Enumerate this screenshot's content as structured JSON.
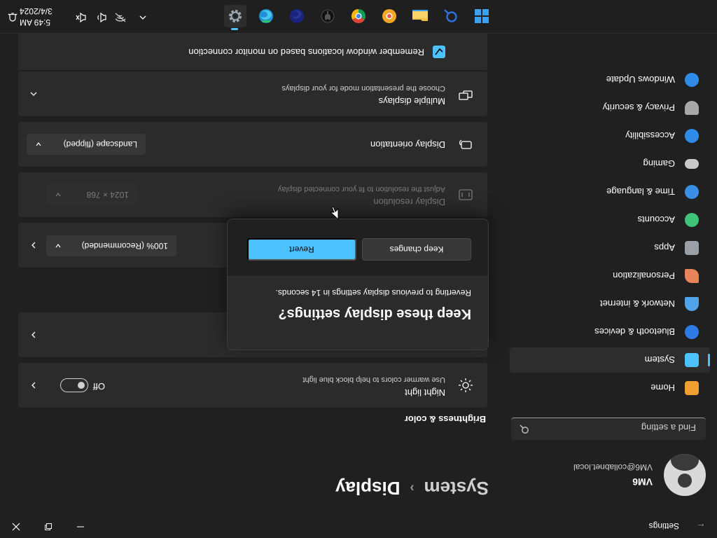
{
  "window": {
    "title": "Settings",
    "back_icon": "back-arrow-icon"
  },
  "profile": {
    "name": "VM6",
    "email": "VM6@collabnet.local"
  },
  "search": {
    "placeholder": "Find a setting"
  },
  "nav": {
    "items": [
      {
        "label": "Home",
        "icon": "home-icon",
        "color": "#f0a030"
      },
      {
        "label": "System",
        "icon": "system-icon",
        "color": "#4cc2ff",
        "selected": true
      },
      {
        "label": "Bluetooth & devices",
        "icon": "bluetooth-icon",
        "color": "#2f7be5"
      },
      {
        "label": "Network & internet",
        "icon": "network-icon",
        "color": "#4fa3e8"
      },
      {
        "label": "Personalization",
        "icon": "brush-icon",
        "color": "#e8845a"
      },
      {
        "label": "Apps",
        "icon": "apps-icon",
        "color": "#9aa0a6"
      },
      {
        "label": "Accounts",
        "icon": "accounts-icon",
        "color": "#3fc27a"
      },
      {
        "label": "Time & language",
        "icon": "globe-clock-icon",
        "color": "#3a8ee6"
      },
      {
        "label": "Gaming",
        "icon": "gamepad-icon",
        "color": "#c9c9c9"
      },
      {
        "label": "Accessibility",
        "icon": "accessibility-icon",
        "color": "#2f8be8"
      },
      {
        "label": "Privacy & security",
        "icon": "shield-icon",
        "color": "#a8a8a8"
      },
      {
        "label": "Windows Update",
        "icon": "update-icon",
        "color": "#2f8be8"
      }
    ]
  },
  "breadcrumb": {
    "parent": "System",
    "current": "Display"
  },
  "brightness_section": {
    "title": "Brightness & color"
  },
  "night_light": {
    "title": "Night light",
    "subtitle": "Use warmer colors to help block blue light",
    "state": "Off"
  },
  "scale": {
    "value": "100% (Recommended)"
  },
  "resolution": {
    "title": "Display resolution",
    "subtitle": "Adjust the resolution to fit your connected display",
    "value": "1024 × 768"
  },
  "orientation": {
    "title": "Display orientation",
    "value": "Landscape (flipped)"
  },
  "multiple_displays": {
    "title": "Multiple displays",
    "subtitle": "Choose the presentation mode for your displays",
    "remember_label": "Remember window locations based on monitor connection",
    "remember_checked": true
  },
  "dialog": {
    "title": "Keep these display settings?",
    "message": "Reverting to previous display settings in 14 seconds.",
    "keep_label": "Keep changes",
    "revert_label": "Revert",
    "accent": "#4cc2ff"
  },
  "taskbar": {
    "apps": [
      "start-icon",
      "search-icon",
      "file-explorer-icon",
      "chrome-canary-icon",
      "chrome-icon",
      "github-icon",
      "edge-dev-icon",
      "edge-icon",
      "settings-icon"
    ],
    "time": "5:49 AM",
    "date": "3/4/2024"
  }
}
